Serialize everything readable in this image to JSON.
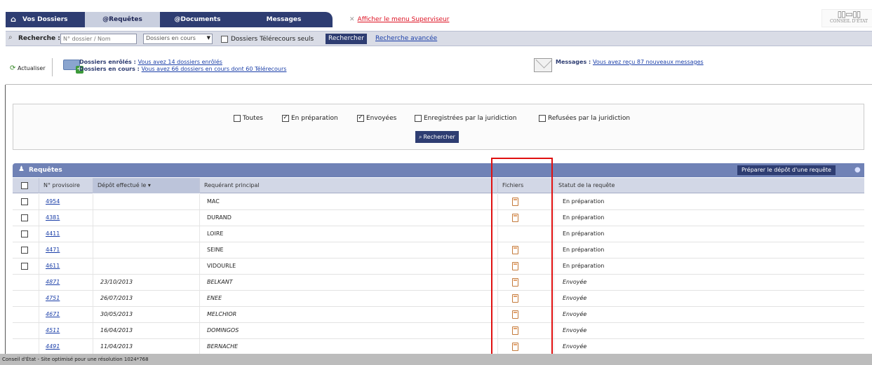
{
  "nav": {
    "tabs": [
      {
        "label": "Vos Dossiers"
      },
      {
        "label": "@Requêtes"
      },
      {
        "label": "@Documents"
      },
      {
        "label": "Messages"
      }
    ],
    "superviseur_link": "Afficher le menu Superviseur",
    "logo_text": "CONSEIL D'ÉTAT"
  },
  "search": {
    "label": "Recherche :",
    "placeholder": "N° dossier / Nom",
    "select_value": "Dossiers en cours",
    "telerecours_label": "Dossiers Télérecours seuls",
    "button": "Rechercher",
    "advanced_link": "Recherche avancée"
  },
  "info": {
    "actualiser": "Actualiser",
    "enroles_label": "Dossiers enrôlés :",
    "enroles_link": "Vous avez 14 dossiers enrôlés",
    "encours_label": "Dossiers en cours :",
    "encours_link": "Vous avez 66 dossiers en cours dont 60 Télérecours",
    "messages_label": "Messages :",
    "messages_link": "Vous avez reçu 87 nouveaux messages"
  },
  "filters": {
    "options": [
      {
        "label": "Toutes",
        "checked": false
      },
      {
        "label": "En préparation",
        "checked": true
      },
      {
        "label": "Envoyées",
        "checked": true
      },
      {
        "label": "Enregistrées par la juridiction",
        "checked": false
      },
      {
        "label": "Refusées par la juridiction",
        "checked": false
      }
    ],
    "button": "Rechercher"
  },
  "table": {
    "title": "Requêtes",
    "prepare_button": "Préparer le dépôt d'une requête",
    "columns": [
      "N° provisoire",
      "Dépôt effectué le",
      "Requérant principal",
      "Fichiers",
      "Statut de la requête"
    ],
    "rows": [
      {
        "num": "4954",
        "date": "",
        "requerant": "MAC",
        "file": true,
        "statut": "En préparation",
        "checkbox": true
      },
      {
        "num": "4381",
        "date": "",
        "requerant": "DURAND",
        "file": true,
        "statut": "En préparation",
        "checkbox": true
      },
      {
        "num": "4411",
        "date": "",
        "requerant": "LOIRE",
        "file": false,
        "statut": "En préparation",
        "checkbox": true
      },
      {
        "num": "4471",
        "date": "",
        "requerant": "SEINE",
        "file": true,
        "statut": "En préparation",
        "checkbox": true
      },
      {
        "num": "4611",
        "date": "",
        "requerant": "VIDOURLE",
        "file": true,
        "statut": "En préparation",
        "checkbox": true
      },
      {
        "num": "4871",
        "date": "23/10/2013",
        "requerant": "BELKANT",
        "file": true,
        "statut": "Envoyée",
        "checkbox": false
      },
      {
        "num": "4751",
        "date": "26/07/2013",
        "requerant": "ENEE",
        "file": true,
        "statut": "Envoyée",
        "checkbox": false
      },
      {
        "num": "4671",
        "date": "30/05/2013",
        "requerant": "MELCHIOR",
        "file": true,
        "statut": "Envoyée",
        "checkbox": false
      },
      {
        "num": "4511",
        "date": "16/04/2013",
        "requerant": "DOMINGOS",
        "file": true,
        "statut": "Envoyée",
        "checkbox": false
      },
      {
        "num": "4491",
        "date": "11/04/2013",
        "requerant": "BERNACHE",
        "file": true,
        "statut": "Envoyée",
        "checkbox": false
      }
    ]
  },
  "footer": "Conseil d'État - Site optimisé pour une résolution 1024*768"
}
